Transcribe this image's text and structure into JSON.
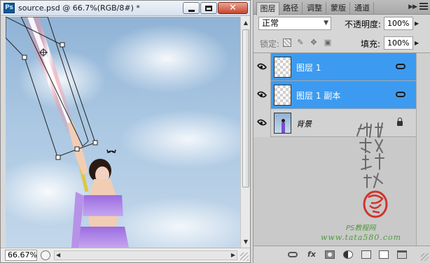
{
  "document": {
    "app_icon": "Ps",
    "title": "source.psd @ 66.7%(RGB/8#) *",
    "close_glyph": "✕",
    "zoom": "66.67%"
  },
  "layers_panel": {
    "tabs": [
      {
        "label": "图层",
        "active": true
      },
      {
        "label": "路径",
        "active": false
      },
      {
        "label": "调整",
        "active": false
      },
      {
        "label": "蒙版",
        "active": false
      },
      {
        "label": "通道",
        "active": false
      }
    ],
    "blend_mode": "正常",
    "opacity_label": "不透明度:",
    "opacity": "100%",
    "lock_label": "锁定:",
    "fill_label": "填充:",
    "fill": "100%",
    "layers": [
      {
        "name": "图层 1",
        "selected": true,
        "visible": true,
        "thumbnail": "transparent",
        "badge": "link-icon"
      },
      {
        "name": "图层 1 副本",
        "selected": true,
        "visible": true,
        "thumbnail": "transparent",
        "badge": "link-icon"
      },
      {
        "name": "背景",
        "selected": false,
        "visible": true,
        "thumbnail": "photo",
        "badge": "lock-icon"
      }
    ],
    "footer_icons": [
      "link-layers-icon",
      "fx-icon",
      "layer-mask-icon",
      "adjustment-layer-icon",
      "new-group-icon",
      "new-layer-icon",
      "delete-layer-icon"
    ]
  },
  "watermark": {
    "signature": "他处我帮你",
    "site": "PS教程网",
    "url": "www.tata580.com"
  },
  "colors": {
    "selection": "#3c9bf0",
    "watermark": "#4d9c3a",
    "seal": "#d0342c"
  }
}
